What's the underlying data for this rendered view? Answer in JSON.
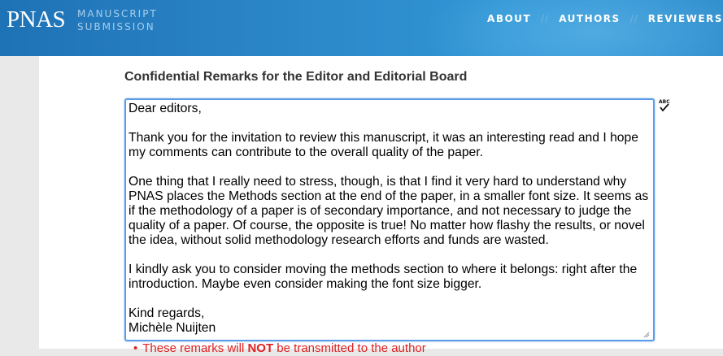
{
  "header": {
    "logo": "PNAS",
    "subtitle_line1": "MANUSCRIPT",
    "subtitle_line2": "SUBMISSION",
    "nav": [
      "ABOUT",
      "AUTHORS",
      "REVIEWERS"
    ]
  },
  "form": {
    "section_title": "Confidential Remarks for the Editor and Editorial Board",
    "remarks_text": "Dear editors,\n\nThank you for the invitation to review this manuscript, it was an interesting read and I hope my comments can contribute to the overall quality of the paper.\n\nOne thing that I really need to stress, though, is that I find it very hard to understand why PNAS places the Methods section at the end of the paper, in a smaller font size. It seems as if the methodology of a paper is of secondary importance, and not necessary to judge the quality of a paper. Of course, the opposite is true! No matter how flashy the results, or novel the idea, without solid methodology research efforts and funds are wasted.\n\nI kindly ask you to consider moving the methods section to where it belongs: right after the introduction. Maybe even consider making the font size bigger.\n\nKind regards,\nMichèle Nuijten",
    "spellcheck_label": "ABC",
    "warning_prefix": "These remarks will ",
    "warning_emphasis": "NOT",
    "warning_suffix": " be transmitted to the author"
  },
  "colors": {
    "header_blue": "#2a84c6",
    "focus_border": "#5b9be8",
    "warning_red": "#e02020"
  },
  "icons": [
    "spellcheck-icon",
    "resize-grip-icon",
    "bullet-icon"
  ]
}
